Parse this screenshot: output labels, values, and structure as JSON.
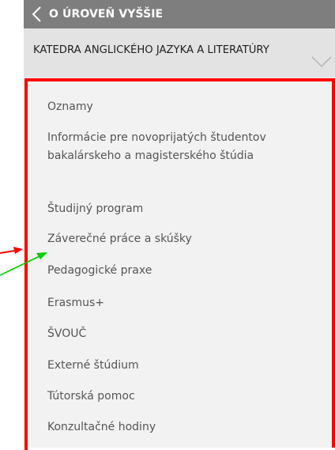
{
  "back_bar": {
    "label": "O ÚROVEŇ VYŠŠIE",
    "icon": "chevron-left-icon"
  },
  "section_header": {
    "title": "KATEDRA ANGLICKÉHO JAZYKA A LITERATÚRY",
    "icon": "chevron-down-icon"
  },
  "menu": {
    "items": [
      {
        "label": "Oznamy"
      },
      {
        "label": "Informácie pre novoprijatých študentov bakalárskeho a magisterského štúdia"
      },
      {
        "label": "Študijný program"
      },
      {
        "label": "Záverečné práce a skúšky"
      },
      {
        "label": "Pedagogické praxe"
      },
      {
        "label": "Erasmus+"
      },
      {
        "label": "ŠVOUČ"
      },
      {
        "label": "Externé štúdium"
      },
      {
        "label": "Tútorská pomoc"
      },
      {
        "label": "Konzultačné hodiny"
      }
    ]
  },
  "colors": {
    "back_bar_bg": "#7e7e7e",
    "section_header_bg": "#e3e3e3",
    "list_bg": "#f2f2f2",
    "text": "#555555",
    "highlight": "#ff0000",
    "arrow_red": "#ff0000",
    "arrow_green": "#00cc00"
  }
}
